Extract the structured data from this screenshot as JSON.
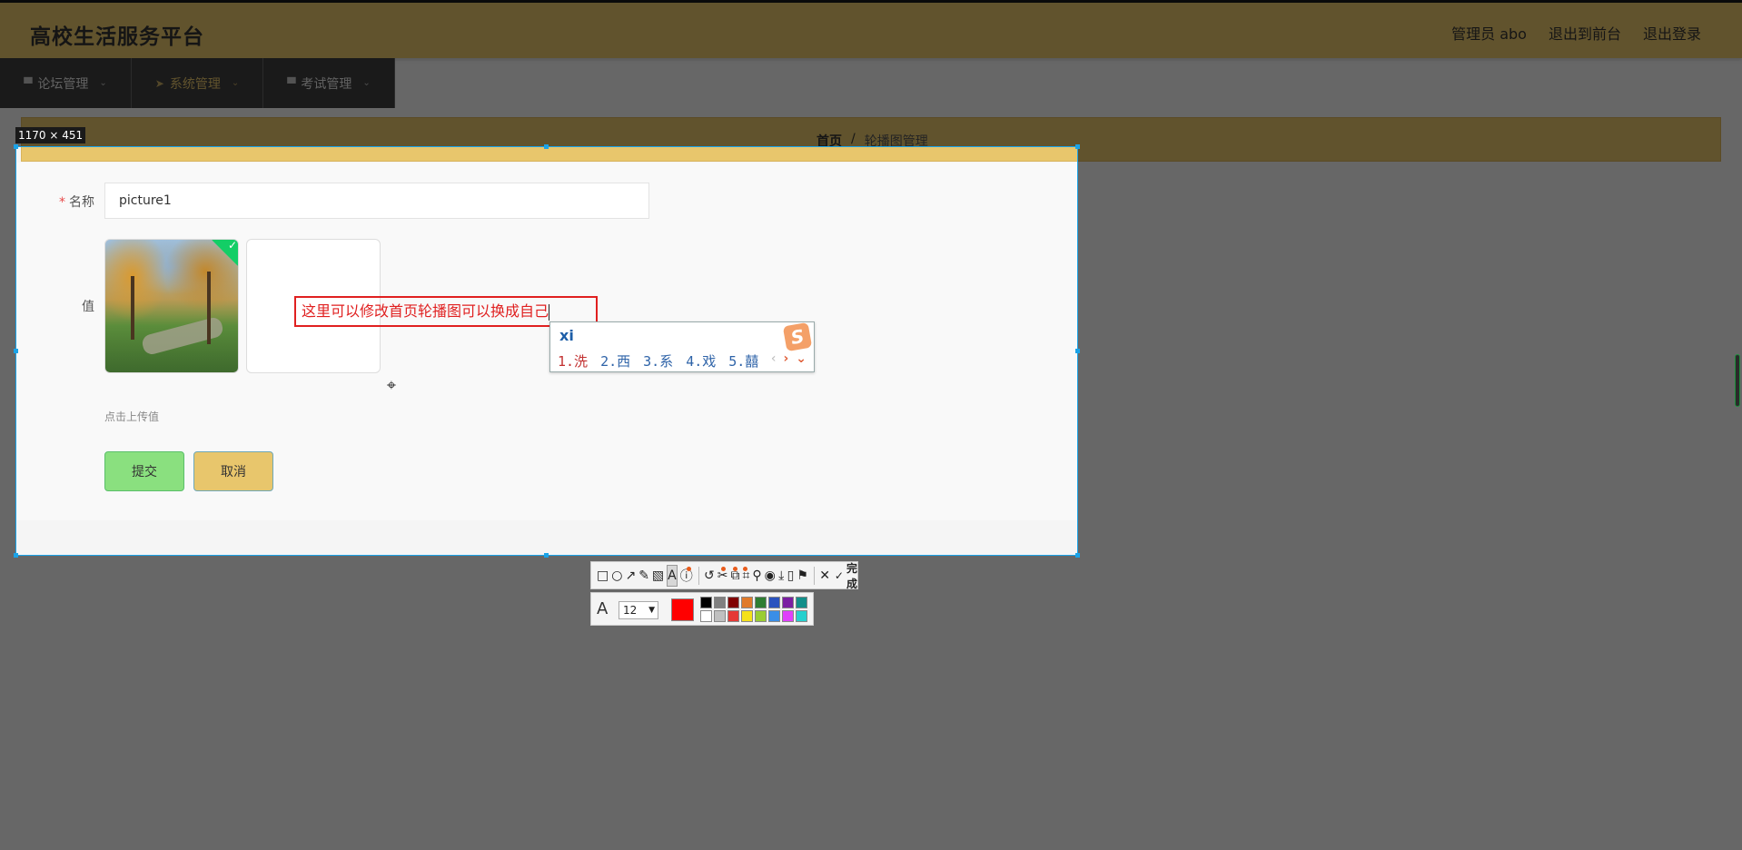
{
  "header": {
    "site_title": "高校生活服务平台",
    "admin_label": "管理员 abo",
    "to_front_label": "退出到前台",
    "logout_label": "退出登录"
  },
  "menu": {
    "items": [
      {
        "label": "论坛管理"
      },
      {
        "label": "系统管理"
      },
      {
        "label": "考试管理"
      }
    ]
  },
  "breadcrumb": {
    "home": "首页",
    "separator": "/",
    "current": "轮播图管理"
  },
  "form": {
    "name_label": "名称",
    "name_value": "picture1",
    "value_label": "值",
    "upload_hint": "点击上传值",
    "submit_label": "提交",
    "cancel_label": "取消"
  },
  "screenshot_tool": {
    "selection_size": "1170 × 451",
    "annotation_text": "这里可以修改首页轮播图可以换成自己",
    "done_label": "完成",
    "font_size": "12",
    "current_color": "#ff0000",
    "palette": [
      "#000000",
      "#808080",
      "#800000",
      "#e07a2a",
      "#2e7d32",
      "#2a52be",
      "#7b1fa2",
      "#138f8a",
      "#ffffff",
      "#c0c0c0",
      "#e53935",
      "#f5e11a",
      "#9acd32",
      "#3a8ee6",
      "#e040fb",
      "#26d0ce"
    ]
  },
  "ime": {
    "input": "xi",
    "candidates": [
      "1.洗",
      "2.西",
      "3.系",
      "4.戏",
      "5.囍"
    ],
    "logo": "S"
  },
  "colors": {
    "accent": "#e8c66c",
    "selection": "#1aa3e8",
    "annotation": "#e02020"
  }
}
